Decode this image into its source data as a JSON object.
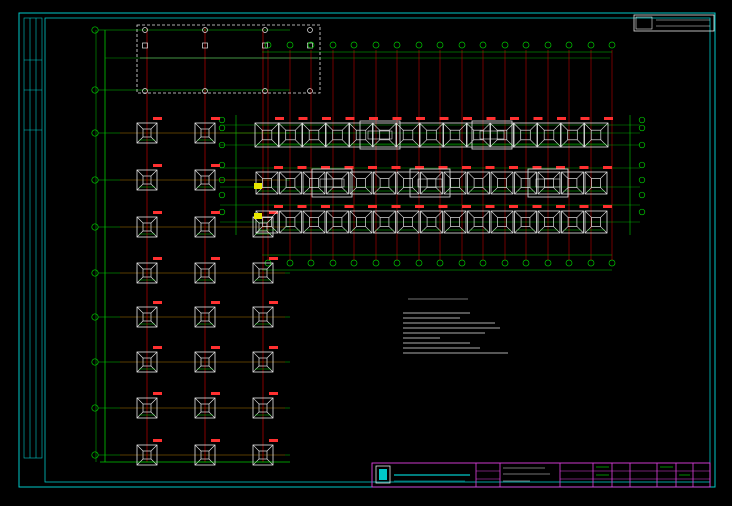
{
  "title_block": {
    "company": "",
    "drawing_title": "",
    "stamp_top_right": ""
  },
  "notes": {
    "heading": "",
    "lines": [
      "",
      "",
      "",
      "",
      "",
      "",
      ""
    ]
  },
  "grid_labels": {
    "left": [
      "",
      "",
      "",
      "",
      "",
      "",
      "",
      "",
      "",
      "",
      ""
    ],
    "top": [
      "",
      "",
      "",
      "",
      "",
      ""
    ]
  },
  "colors": {
    "background": "#000000",
    "frame": "#00c8c8",
    "grid_green": "#00c800",
    "axis_red": "#e00000",
    "footing_white": "#e6e6e6",
    "label_red": "#ff3030",
    "note_magenta": "#e040e0"
  }
}
